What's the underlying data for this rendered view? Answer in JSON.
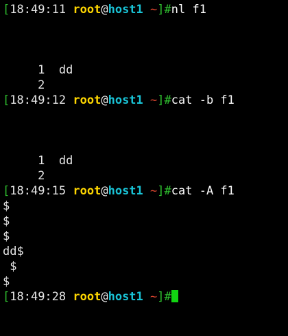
{
  "prompt": {
    "open_bracket": "[",
    "user": "root",
    "at": "@",
    "host": "host1",
    "path": "~",
    "close_bracket": "]#"
  },
  "colors": {
    "background": "#000000",
    "bracket": "#2fc02f",
    "user": "#ffd700",
    "host": "#19c3d6",
    "path": "#d9442e",
    "cursor": "#12d312"
  },
  "blocks": [
    {
      "time": "18:49:11",
      "command": "nl f1",
      "output": [
        "",
        "",
        "",
        "     1  dd",
        "     2"
      ]
    },
    {
      "time": "18:49:12",
      "command": "cat -b f1",
      "output": [
        "",
        "",
        "",
        "     1  dd",
        "     2"
      ]
    },
    {
      "time": "18:49:15",
      "command": "cat -A f1",
      "output": [
        "$",
        "$",
        "$",
        "dd$",
        " $",
        "$"
      ]
    }
  ],
  "final_prompt": {
    "time": "18:49:28"
  }
}
